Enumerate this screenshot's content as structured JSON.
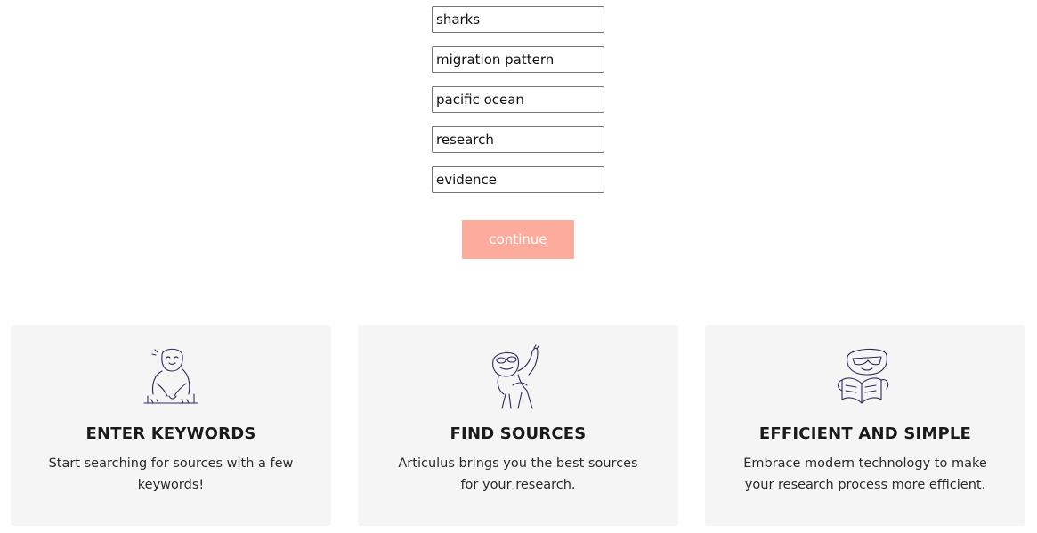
{
  "keywords": {
    "values": [
      "sharks",
      "migration pattern",
      "pacific ocean",
      "research",
      "evidence"
    ]
  },
  "continue_label": "continue",
  "colors": {
    "accent": "#fdab9c",
    "card_background": "#f5f5f5",
    "illustration_stroke": "#2d2a57"
  },
  "features": [
    {
      "icon": "person-typing-illustration",
      "title": "ENTER KEYWORDS",
      "text": "Start searching for sources with a few keywords!"
    },
    {
      "icon": "person-waving-illustration",
      "title": "FIND SOURCES",
      "text": "Articulus brings you the best sources for your research."
    },
    {
      "icon": "person-reading-illustration",
      "title": "EFFICIENT AND SIMPLE",
      "text": "Embrace modern technology to make your research process more efficient."
    }
  ]
}
